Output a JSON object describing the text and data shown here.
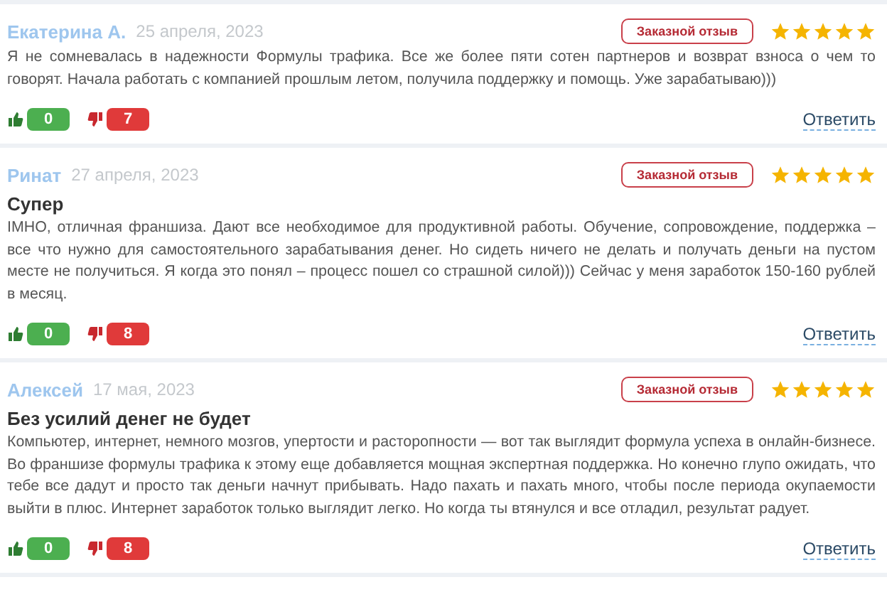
{
  "reviews": [
    {
      "author": "Екатерина А.",
      "date": "25 апреля, 2023",
      "badge": "Заказной отзыв",
      "stars": 5,
      "text": "Я не сомневалась в надежности Формулы трафика. Все же более пяти сотен партнеров и возврат взноса о чем то говорят. Начала работать с компанией прошлым летом, получила поддержку и помощь. Уже зарабатываю)))",
      "likes": "0",
      "dislikes": "7",
      "reply": "Ответить"
    },
    {
      "author": "Ринат",
      "date": "27 апреля, 2023",
      "badge": "Заказной отзыв",
      "stars": 5,
      "title": "Супер",
      "text": "IMHO, отличная франшиза. Дают все необходимое для продуктивной работы. Обучение, сопровождение, поддержка – все что нужно для самостоятельного зарабатывания денег. Но сидеть ничего не делать и получать деньги на пустом месте не получиться. Я когда это понял – процесс пошел со страшной силой))) Сейчас у меня заработок 150-160 рублей в месяц.",
      "likes": "0",
      "dislikes": "8",
      "reply": "Ответить"
    },
    {
      "author": "Алексей",
      "date": "17 мая, 2023",
      "badge": "Заказной отзыв",
      "stars": 5,
      "title": "Без усилий денег не будет",
      "text": "Компьютер, интернет, немного мозгов, упертости и расторопности — вот так выглядит формула успеха в онлайн-бизнесе. Во франшизе формулы трафика к этому еще добавляется мощная экспертная поддержка. Но конечно глупо ожидать, что тебе все дадут и просто так деньги начнут прибывать. Надо пахать и пахать много, чтобы после периода окупаемости выйти в плюс. Интернет заработок только выглядит легко. Но когда ты втянулся и все отладил, результат радует.",
      "likes": "0",
      "dislikes": "8",
      "reply": "Ответить"
    }
  ]
}
